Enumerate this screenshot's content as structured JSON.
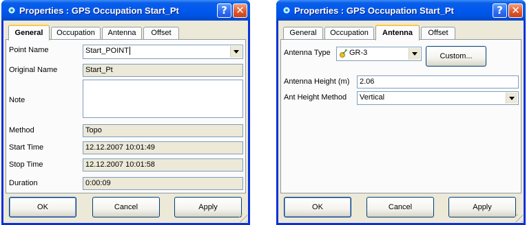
{
  "dialog1": {
    "title": "Properties : GPS Occupation Start_Pt",
    "help": "?",
    "close": "✕",
    "tabs": [
      "General",
      "Occupation",
      "Antenna",
      "Offset"
    ],
    "active_tab": "General",
    "fields": {
      "point_name": {
        "label": "Point Name",
        "value": "Start_POINT"
      },
      "original_name": {
        "label": "Original Name",
        "value": "Start_Pt"
      },
      "note": {
        "label": "Note",
        "value": ""
      },
      "method": {
        "label": "Method",
        "value": "Topo"
      },
      "start_time": {
        "label": "Start Time",
        "value": "12.12.2007 10:01:49"
      },
      "stop_time": {
        "label": "Stop Time",
        "value": "12.12.2007 10:01:58"
      },
      "duration": {
        "label": "Duration",
        "value": "0:00:09"
      }
    },
    "buttons": {
      "ok": "OK",
      "cancel": "Cancel",
      "apply": "Apply"
    }
  },
  "dialog2": {
    "title": "Properties : GPS Occupation Start_Pt",
    "help": "?",
    "close": "✕",
    "tabs": [
      "General",
      "Occupation",
      "Antenna",
      "Offset"
    ],
    "active_tab": "Antenna",
    "fields": {
      "antenna_type": {
        "label": "Antenna Type",
        "value": "GR-3"
      },
      "custom_button": "Custom...",
      "antenna_height": {
        "label": "Antenna Height (m)",
        "value": "2.06"
      },
      "ant_height_method": {
        "label": "Ant Height Method",
        "value": "Vertical"
      }
    },
    "buttons": {
      "ok": "OK",
      "cancel": "Cancel",
      "apply": "Apply"
    }
  },
  "colors": {
    "titlebar": "#0058ee",
    "dialog_bg": "#ece9d8",
    "active_tab_accent": "#ffc83c",
    "close_button": "#e25a2e"
  }
}
